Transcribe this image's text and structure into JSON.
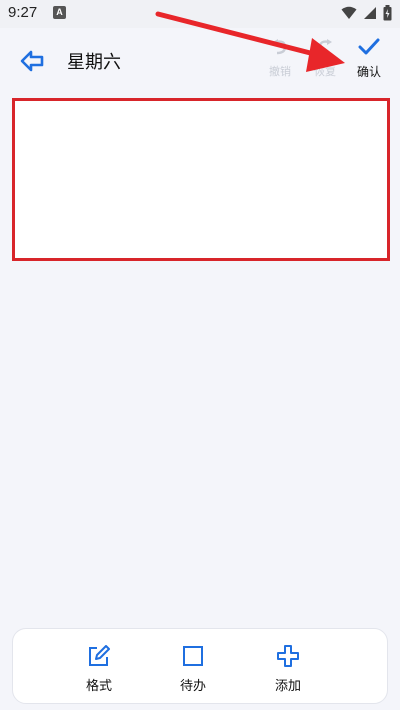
{
  "status": {
    "time": "9:27",
    "notif_letter": "A"
  },
  "header": {
    "title": "星期六",
    "undo_label": "撤销",
    "redo_label": "恢复",
    "confirm_label": "确认"
  },
  "editor": {
    "content": ""
  },
  "bottom_bar": {
    "format_label": "格式",
    "todo_label": "待办",
    "add_label": "添加"
  },
  "colors": {
    "accent": "#1f6fe0",
    "annotation": "#d8252a",
    "background": "#f4f5fa",
    "disabled": "#c9cdd6"
  },
  "icons": {
    "back": "arrow-left-icon",
    "undo": "undo-icon",
    "redo": "redo-icon",
    "confirm": "check-icon",
    "format": "edit-icon",
    "todo": "checkbox-icon",
    "add": "plus-icon"
  }
}
